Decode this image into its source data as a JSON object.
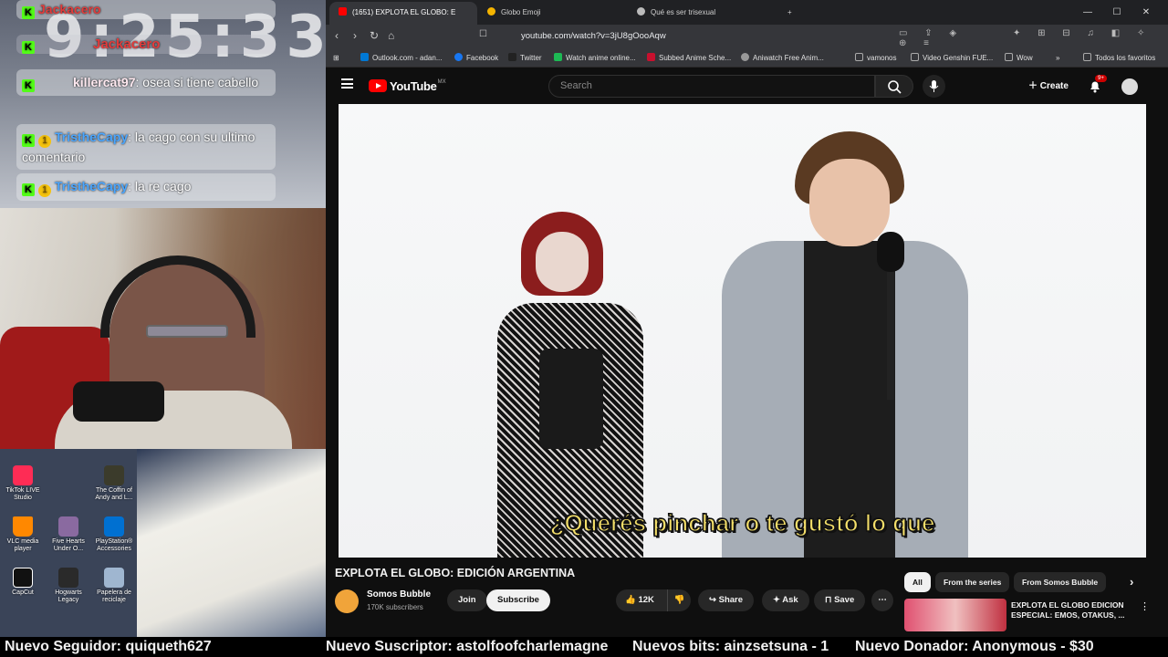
{
  "overlay": {
    "clock": "9:25:33",
    "chat": [
      {
        "user": "Jackacero",
        "text": ""
      },
      {
        "user": "killercat97",
        "text": ": osea si tiene cabello"
      },
      {
        "user": "TristheCapy",
        "text": ": la cago con su ultimo comentario"
      },
      {
        "user": "TristheCapy",
        "text": ": la re cago"
      }
    ],
    "desktop_icons": [
      {
        "label": "TikTok LIVE Studio",
        "icon": "tiktok-icon"
      },
      {
        "label": "The Coffin of Andy and L...",
        "icon": "game-icon"
      },
      {
        "label": "VLC media player",
        "icon": "vlc-icon"
      },
      {
        "label": "Five Hearts Under O...",
        "icon": "game-icon"
      },
      {
        "label": "PlayStation® Accessories",
        "icon": "playstation-icon"
      },
      {
        "label": "CapCut",
        "icon": "capcut-icon"
      },
      {
        "label": "Hogwarts Legacy",
        "icon": "game-icon"
      },
      {
        "label": "Papelera de reciclaje",
        "icon": "recycle-bin-icon"
      }
    ]
  },
  "browser": {
    "tabs": [
      {
        "label": "(1651) EXPLOTA EL GLOBO: E",
        "color": "#ff0000",
        "active": true
      },
      {
        "label": "Globo Emoji",
        "color": "#f4b400",
        "active": false
      },
      {
        "label": "Qué es ser trisexual",
        "color": "#bbbbbb",
        "active": false
      }
    ],
    "url": "youtube.com/watch?v=3jU8gOooAqw",
    "bookmarks": [
      {
        "label": "Outlook.com - adan...",
        "color": "#0078d4"
      },
      {
        "label": "Facebook",
        "color": "#1877f2"
      },
      {
        "label": "Twitter",
        "color": "#222222"
      },
      {
        "label": "Watch anime online...",
        "color": "#1db954"
      },
      {
        "label": "Subbed Anime Sche...",
        "color": "#c8102e"
      },
      {
        "label": "Aniwatch Free Anim...",
        "color": "#999999"
      },
      {
        "label": "vamonos",
        "color": "#aaaaaa"
      },
      {
        "label": "Video Genshin FUE...",
        "color": "#aaaaaa"
      },
      {
        "label": "Wow",
        "color": "#aaaaaa"
      },
      {
        "label": "Todos los favoritos",
        "color": "#aaaaaa"
      }
    ]
  },
  "youtube": {
    "logo": "YouTube",
    "country": "MX",
    "search_placeholder": "Search",
    "create_label": "Create",
    "notif_count": "9+",
    "caption": "¿Querés pinchar o te gustó lo que",
    "title": "EXPLOTA EL GLOBO: EDICIÓN ARGENTINA",
    "channel": {
      "name": "Somos Bubble",
      "subs": "170K subscribers"
    },
    "join_label": "Join",
    "subscribe_label": "Subscribe",
    "likes": "12K",
    "share_label": "Share",
    "ask_label": "Ask",
    "save_label": "Save",
    "chips": [
      "All",
      "From the series",
      "From Somos Bubble"
    ],
    "recommendation": {
      "title": "EXPLOTA EL GLOBO EDICION ESPECIAL: EMOS, OTAKUS, ..."
    }
  },
  "ticker": {
    "follower": "Nuevo Seguidor: quiqueth627",
    "subscriber": "Nuevo Suscriptor: astolfoofcharlemagne",
    "bits": "Nuevos bits: ainzsetsuna - 1",
    "donor": "Nuevo Donador: Anonymous - $30"
  }
}
